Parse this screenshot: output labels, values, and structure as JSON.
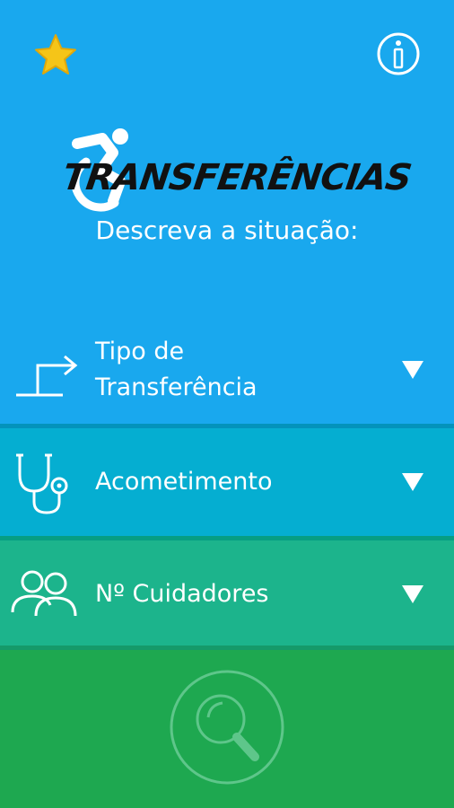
{
  "header": {
    "favorite_icon": "star-icon",
    "info_icon": "info-icon",
    "logo_text": "TRANSFERÊNCIAS",
    "subtitle": "Descreva a situação:"
  },
  "filters": [
    {
      "label_line1": "Tipo de",
      "label_line2": "Transferência",
      "icon": "transfer-arrow-icon"
    },
    {
      "label": "Acometimento",
      "icon": "stethoscope-icon"
    },
    {
      "label": "Nº Cuidadores",
      "icon": "people-icon"
    }
  ],
  "search": {
    "icon": "search-icon"
  },
  "colors": {
    "top": "#19a8ee",
    "row2": "#05aed1",
    "row3": "#1cb48c",
    "bottom": "#1ea850",
    "star": "#f5c518"
  }
}
